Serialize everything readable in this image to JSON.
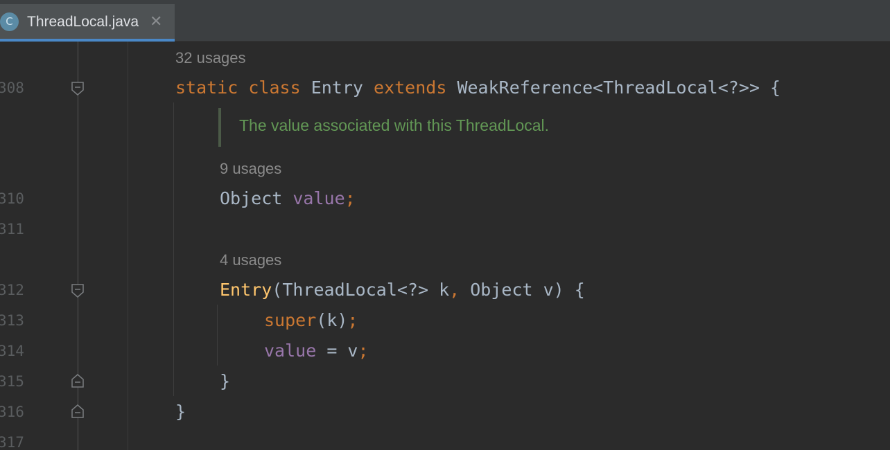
{
  "tab": {
    "icon_letter": "C",
    "title": "ThreadLocal.java",
    "close_glyph": "✕"
  },
  "line_numbers": [
    "308",
    "310",
    "311",
    "312",
    "313",
    "314",
    "315",
    "316",
    "317"
  ],
  "usages": {
    "class": "32 usages",
    "field": "9 usages",
    "constructor": "4 usages"
  },
  "doc_comment": "The value associated with this ThreadLocal.",
  "code": {
    "l308": {
      "kw1": "static",
      "kw2": "class",
      "name": "Entry",
      "kw3": "extends",
      "rest": "WeakReference<ThreadLocal<?>> {"
    },
    "l310": {
      "type": "Object",
      "field": "value",
      "semi": ";"
    },
    "l312": {
      "ctor": "Entry",
      "open": "(ThreadLocal<?> k",
      "comma": ",",
      "rest": " Object v) {"
    },
    "l313": {
      "kw": "super",
      "rest": "(k)",
      "semi": ";"
    },
    "l314": {
      "field": "value",
      "rest": " = v",
      "semi": ";"
    },
    "l315": {
      "brace": "}"
    },
    "l316": {
      "brace": "}"
    }
  },
  "colors": {
    "background": "#2b2b2b",
    "keyword": "#cc7832",
    "field": "#9876aa",
    "function": "#ffc66d",
    "identifier": "#a9b7c6",
    "doc": "#629755",
    "tab_accent": "#4a88c7"
  },
  "icons": [
    "class-icon",
    "close-icon",
    "fold-icon"
  ]
}
